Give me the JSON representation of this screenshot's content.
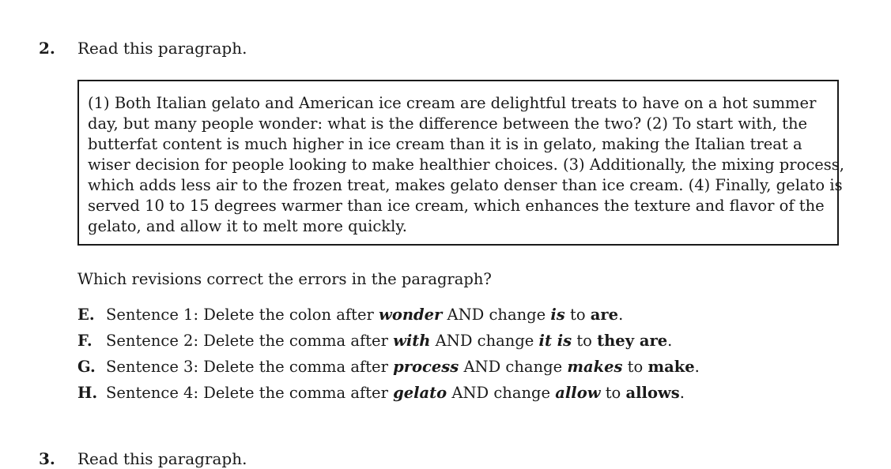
{
  "question": {
    "number": "2.",
    "prompt": "Read this paragraph.",
    "passage_lines": [
      "(1) Both Italian gelato and American ice cream are delightful treats to have on a hot summer",
      "day, but many people wonder: what is the difference between the two?  (2) To start with, the",
      "butterfat content is much higher in ice cream than it is in gelato, making the Italian treat a",
      "wiser decision for people looking to make healthier choices.  (3) Additionally, the mixing process,",
      "which adds less air to the frozen treat, makes gelato denser than ice cream.  (4) Finally, gelato is",
      "served 10 to 15 degrees warmer than ice cream, which enhances the texture and flavor of the",
      "gelato, and allow it to melt more quickly."
    ],
    "stem": "Which revisions correct the errors in the paragraph?",
    "choices": [
      {
        "letter": "E.",
        "pre": "Sentence 1: Delete the colon after ",
        "target": "wonder",
        "mid": " AND change ",
        "from": "is",
        "to_word": " to ",
        "replacement": "are",
        "end": "."
      },
      {
        "letter": "F.",
        "pre": "Sentence 2: Delete the comma after ",
        "target": "with",
        "mid": " AND change ",
        "from": "it is",
        "to_word": " to ",
        "replacement": "they are",
        "end": "."
      },
      {
        "letter": "G.",
        "pre": "Sentence 3: Delete the comma after ",
        "target": "process",
        "mid": " AND change ",
        "from": "makes",
        "to_word": " to ",
        "replacement": "make",
        "end": "."
      },
      {
        "letter": "H.",
        "pre": "Sentence 4: Delete the comma after ",
        "target": "gelato",
        "mid": " AND change ",
        "from": "allow",
        "to_word": " to ",
        "replacement": "allows",
        "end": "."
      }
    ]
  },
  "next_question": {
    "number": "3.",
    "prompt": "Read this paragraph."
  }
}
